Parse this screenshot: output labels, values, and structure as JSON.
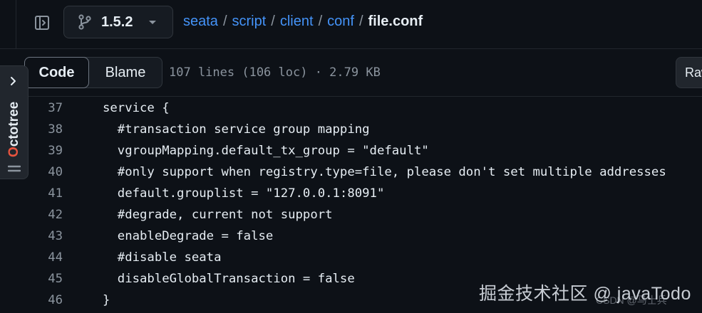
{
  "header": {
    "branch_label": "1.5.2",
    "breadcrumb": {
      "parts": [
        "seata",
        "script",
        "client",
        "conf"
      ],
      "separator": "/",
      "current": "file.conf"
    }
  },
  "toolbar": {
    "code_label": "Code",
    "blame_label": "Blame",
    "file_stats": "107 lines (106 loc) · 2.79 KB",
    "raw_label": "Raw"
  },
  "code": {
    "lines": [
      {
        "num": "37",
        "text": "service {"
      },
      {
        "num": "38",
        "text": "  #transaction service group mapping"
      },
      {
        "num": "39",
        "text": "  vgroupMapping.default_tx_group = \"default\""
      },
      {
        "num": "40",
        "text": "  #only support when registry.type=file, please don't set multiple addresses"
      },
      {
        "num": "41",
        "text": "  default.grouplist = \"127.0.0.1:8091\""
      },
      {
        "num": "42",
        "text": "  #degrade, current not support"
      },
      {
        "num": "43",
        "text": "  enableDegrade = false"
      },
      {
        "num": "44",
        "text": "  #disable seata"
      },
      {
        "num": "45",
        "text": "  disableGlobalTransaction = false"
      },
      {
        "num": "46",
        "text": "}"
      }
    ]
  },
  "octotree": {
    "label_first": "O",
    "label_rest": "ctotree"
  },
  "watermark": {
    "main": "掘金技术社区 @ javaTodo",
    "small": "CSDN @马士兵"
  },
  "icons": {
    "sidebar_toggle": "sidebar-toggle-icon",
    "branch": "git-branch-icon",
    "chevron_down": "chevron-down-icon",
    "chevron_right": "chevron-right-icon",
    "menu": "menu-icon"
  },
  "colors": {
    "background": "#0d1117",
    "link": "#4493f8",
    "muted": "#8b949e",
    "text": "#e6edf3",
    "octotree_accent": "#e8543f"
  }
}
